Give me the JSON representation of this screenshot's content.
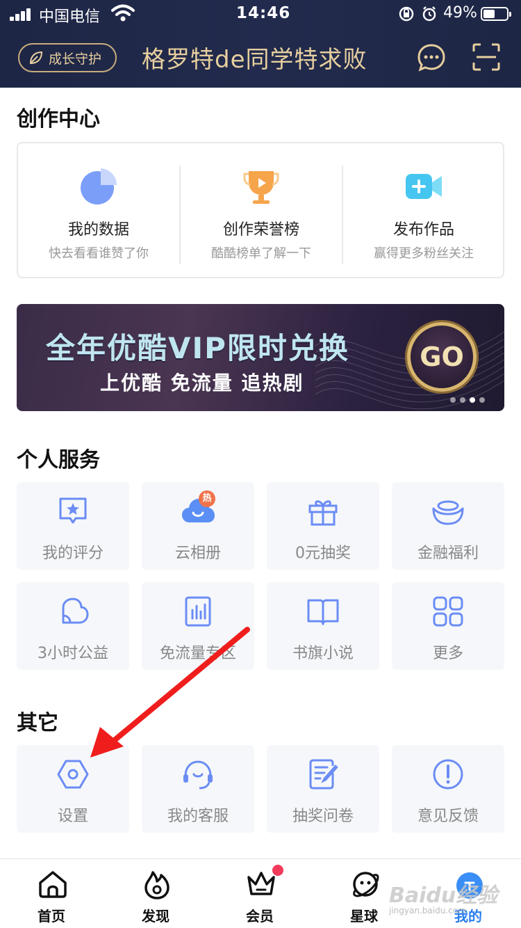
{
  "status_bar": {
    "carrier": "中国电信",
    "time": "14:46",
    "battery": "49%"
  },
  "header": {
    "guard_label": "成长守护",
    "username": "格罗特de同学特求败"
  },
  "creation": {
    "title": "创作中心",
    "items": [
      {
        "title": "我的数据",
        "subtitle": "快去看看谁赞了你",
        "icon": "pie-chart-icon"
      },
      {
        "title": "创作荣誉榜",
        "subtitle": "酷酷榜单了解一下",
        "icon": "trophy-icon"
      },
      {
        "title": "发布作品",
        "subtitle": "赢得更多粉丝关注",
        "icon": "video-add-icon"
      }
    ]
  },
  "banner": {
    "title": "全年优酷VIP限时兑换",
    "subtitle": "上优酷 免流量 追热剧",
    "button": "GO",
    "slide_index": 3,
    "slide_count": 4
  },
  "services": {
    "title": "个人服务",
    "items": [
      {
        "label": "我的评分",
        "icon": "star-chat-icon"
      },
      {
        "label": "云相册",
        "icon": "cloud-icon",
        "badge": "热"
      },
      {
        "label": "0元抽奖",
        "icon": "gift-icon"
      },
      {
        "label": "金融福利",
        "icon": "ingot-icon"
      },
      {
        "label": "3小时公益",
        "icon": "heart-icon"
      },
      {
        "label": "免流量专区",
        "icon": "data-icon"
      },
      {
        "label": "书旗小说",
        "icon": "book-icon"
      },
      {
        "label": "更多",
        "icon": "grid-icon"
      }
    ]
  },
  "other": {
    "title": "其它",
    "items": [
      {
        "label": "设置",
        "icon": "settings-icon"
      },
      {
        "label": "我的客服",
        "icon": "headset-icon"
      },
      {
        "label": "抽奖问卷",
        "icon": "survey-icon"
      },
      {
        "label": "意见反馈",
        "icon": "feedback-icon"
      }
    ]
  },
  "tabs": [
    {
      "label": "首页",
      "icon": "home-icon"
    },
    {
      "label": "发现",
      "icon": "flame-icon"
    },
    {
      "label": "会员",
      "icon": "crown-icon"
    },
    {
      "label": "星球",
      "icon": "planet-icon"
    },
    {
      "label": "我的",
      "icon": "profile-icon",
      "active": true
    }
  ],
  "watermark": {
    "text": "Baidu经验",
    "url": "jingyan.baidu.com"
  },
  "colors": {
    "header_bg": "#1e2645",
    "gold": "#e7cf9f",
    "accent": "#2a7ff0",
    "icon_blue": "#6b8cf5"
  }
}
